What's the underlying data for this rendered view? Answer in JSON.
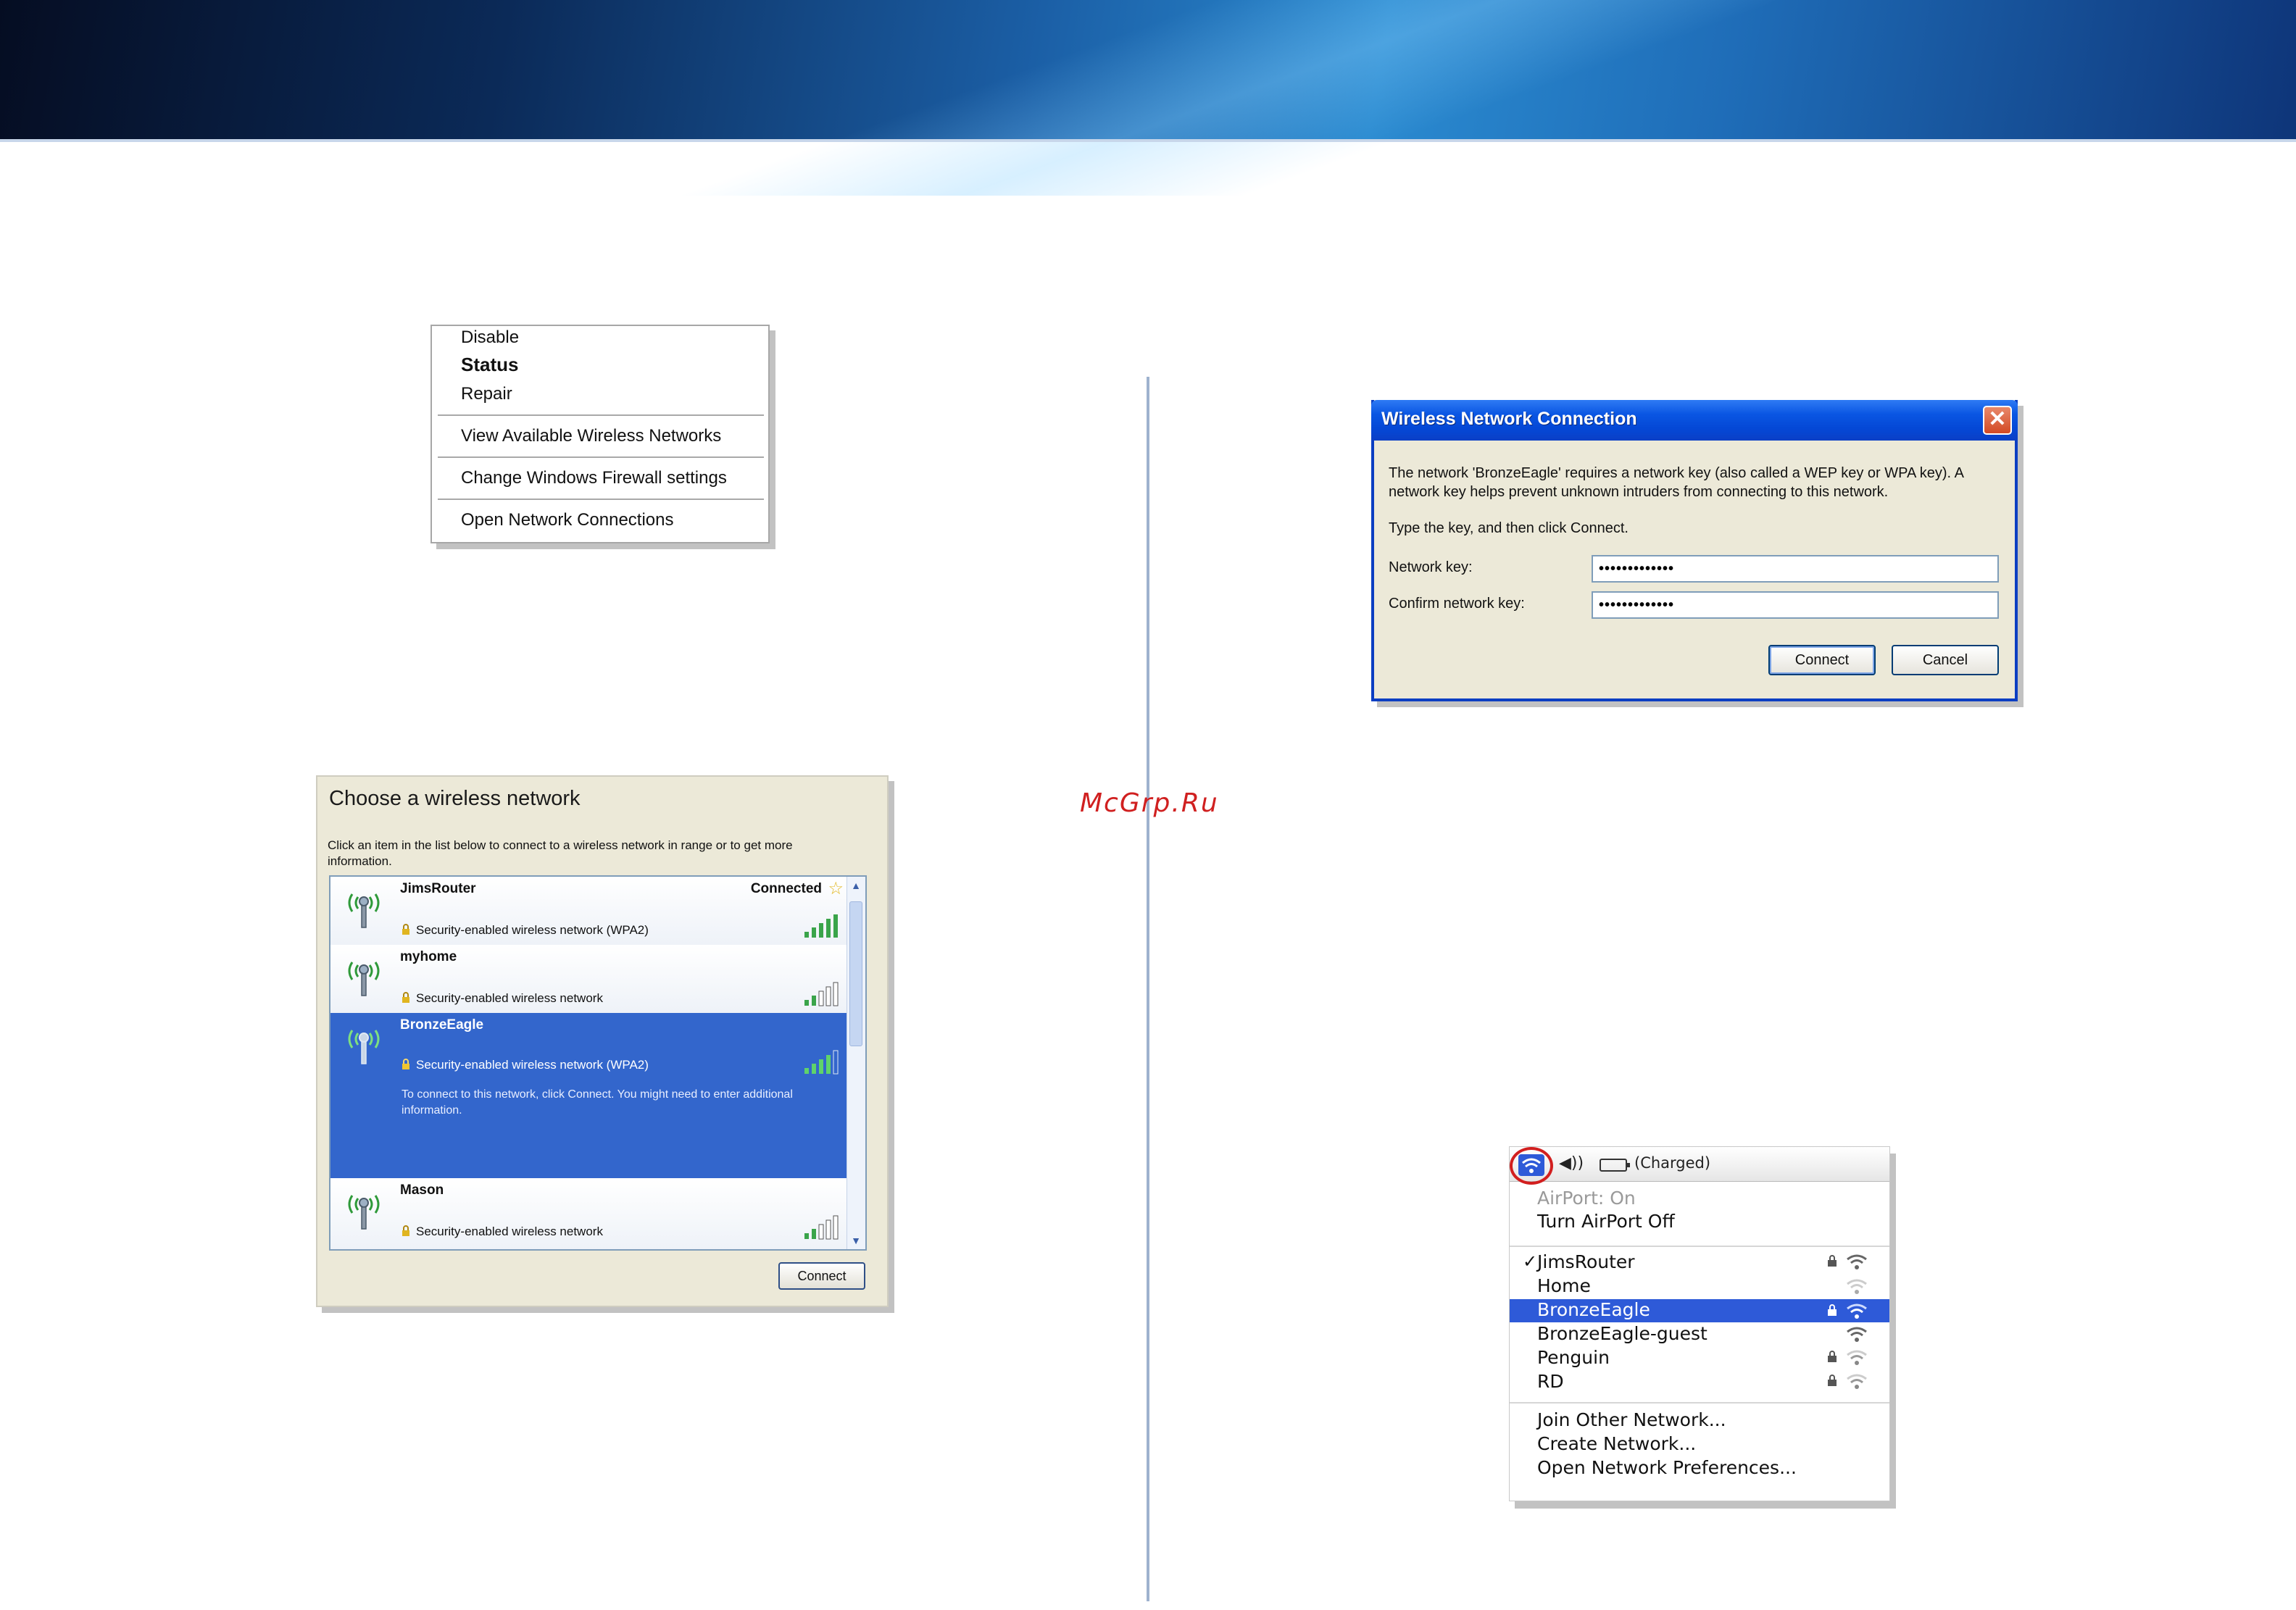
{
  "watermark": "McGrp.Ru",
  "context_menu": {
    "items": [
      "Disable",
      "Status",
      "Repair",
      "View Available Wireless Networks",
      "Change Windows Firewall settings",
      "Open Network Connections"
    ]
  },
  "choose_network": {
    "title": "Choose a wireless network",
    "description": "Click an item in the list below to connect to a wireless network in range or to get more information.",
    "networks": [
      {
        "name": "JimsRouter",
        "security": "Security-enabled wireless network (WPA2)",
        "status": "Connected"
      },
      {
        "name": "myhome",
        "security": "Security-enabled wireless network"
      },
      {
        "name": "BronzeEagle",
        "security": "Security-enabled wireless network (WPA2)",
        "info": "To connect to this network, click Connect. You might need to enter additional information."
      },
      {
        "name": "Mason",
        "security": "Security-enabled wireless network"
      }
    ],
    "connect_label": "Connect"
  },
  "wnc_dialog": {
    "title": "Wireless Network Connection",
    "close": "✕",
    "message": "The network 'BronzeEagle' requires a network key (also called a WEP key or WPA key). A network key helps prevent unknown intruders from connecting to this network.",
    "instruction": "Type the key, and then click Connect.",
    "network_key_label": "Network key:",
    "network_key_value": "•••••••••••••",
    "confirm_key_label": "Confirm network key:",
    "confirm_key_value": "•••••••••••••",
    "connect_label": "Connect",
    "cancel_label": "Cancel"
  },
  "mac_menu": {
    "battery_text": "(Charged)",
    "volume_icon": "speaker-icon",
    "airport_status": "AirPort: On",
    "turn_off": "Turn AirPort Off",
    "checkmark": "✓",
    "networks": [
      {
        "name": "JimsRouter",
        "locked": true,
        "checked": true
      },
      {
        "name": "Home",
        "locked": false
      },
      {
        "name": "BronzeEagle",
        "locked": true,
        "selected": true
      },
      {
        "name": "BronzeEagle-guest",
        "locked": false
      },
      {
        "name": "Penguin",
        "locked": true
      },
      {
        "name": "RD",
        "locked": true
      }
    ],
    "actions": [
      "Join Other Network...",
      "Create Network...",
      "Open Network Preferences..."
    ]
  },
  "colors": {
    "xp_selection": "#3366cc",
    "xp_title_bar": "#0a56e3",
    "mac_selection": "#2e5ad8",
    "highlight_circle": "#d21f1f"
  }
}
